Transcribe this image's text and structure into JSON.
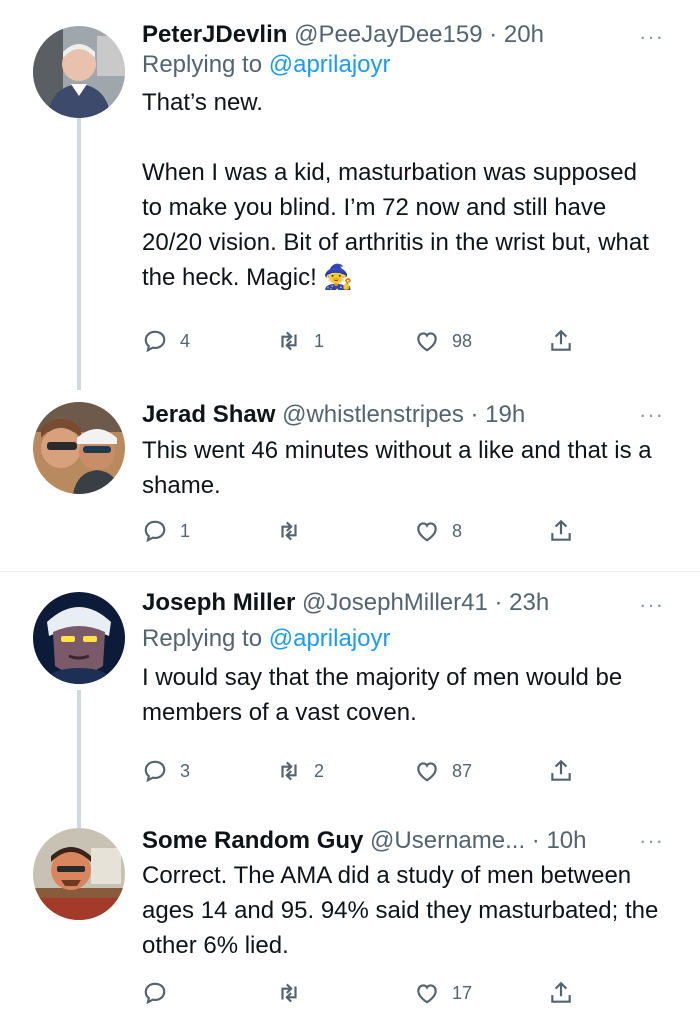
{
  "threads": [
    {
      "tweets": [
        {
          "name": "PeterJDevlin",
          "handle": "@PeeJayDee159",
          "time": "20h",
          "replying_prefix": "Replying to ",
          "replying_to": "@aprilajoyr",
          "text": "That’s new.\n\nWhen I was a kid, masturbation was supposed to make you blind. I’m 72 now and still have 20/20 vision. Bit of arthritis in the wrist but, what the heck. Magic! 🧙",
          "reply_count": "4",
          "retweet_count": "1",
          "like_count": "98"
        },
        {
          "name": "Jerad Shaw",
          "handle": "@whistlenstripes",
          "time": "19h",
          "text": "This went 46 minutes without a like and that is a shame.",
          "reply_count": "1",
          "retweet_count": "",
          "like_count": "8"
        }
      ]
    },
    {
      "tweets": [
        {
          "name": "Joseph Miller",
          "handle": "@JosephMiller41",
          "time": "23h",
          "replying_prefix": "Replying to ",
          "replying_to": "@aprilajoyr",
          "text": "I would say that the majority of men would be members of a vast coven.",
          "reply_count": "3",
          "retweet_count": "2",
          "like_count": "87"
        },
        {
          "name": "Some Random Guy",
          "handle": "@Username...",
          "time": "10h",
          "text": "Correct. The AMA did a study of men between ages 14 and 95. 94% said they masturbated; the other 6% lied.",
          "reply_count": "",
          "retweet_count": "",
          "like_count": "17"
        }
      ]
    }
  ],
  "separator": " · ",
  "more_label": "···",
  "icons": {
    "reply": "reply-icon",
    "retweet": "retweet-icon",
    "like": "like-icon",
    "share": "share-icon",
    "more": "more-icon"
  },
  "colors": {
    "text": "#0f1419",
    "secondary": "#536471",
    "link": "#1d9bf0",
    "thread_line": "#cfd9de"
  }
}
